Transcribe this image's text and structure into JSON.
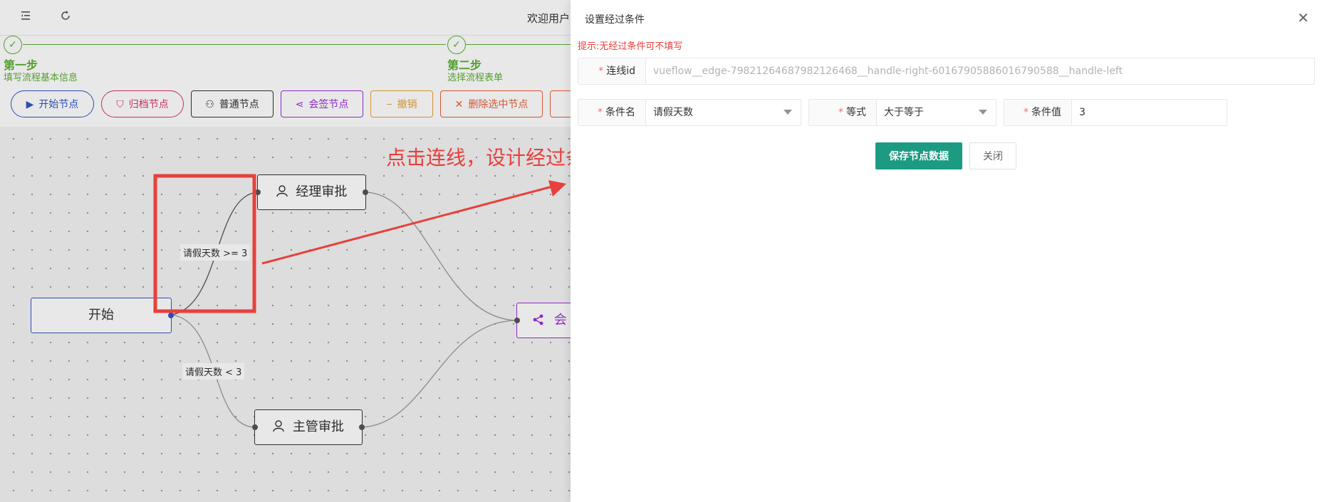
{
  "topbar": {
    "menu_icon": "collapse-menu-icon",
    "refresh_icon": "refresh-icon",
    "welcome": "欢迎用户["
  },
  "steps": [
    {
      "title": "第一步",
      "desc": "填写流程基本信息"
    },
    {
      "title": "第二步",
      "desc": "选择流程表单"
    }
  ],
  "toolbar": {
    "start_node": "开始节点",
    "archive_node": "归档节点",
    "normal_node": "普通节点",
    "countersign_node": "会签节点",
    "undo": "撤销",
    "delete_selected": "删除选中节点"
  },
  "canvas": {
    "nodes": {
      "start": "开始",
      "manager": "经理审批",
      "supervisor": "主管审批",
      "countersign": "会"
    },
    "edges": {
      "upper_label": "请假天数 >= 3",
      "lower_label": "请假天数 < 3"
    }
  },
  "annotation": {
    "text": "点击连线，设计经过条件"
  },
  "drawer": {
    "title": "设置经过条件",
    "close_icon": "close-icon",
    "hint": "提示:无经过条件可不填写",
    "edge_id_label": "连线id",
    "edge_id_value": "vueflow__edge-7982126468798212646​8__handle-right-6016790588601679058​8__handle-left",
    "condition_name_label": "条件名",
    "condition_name_value": "请假天数",
    "operator_label": "等式",
    "operator_value": "大于等于",
    "condition_value_label": "条件值",
    "condition_value_value": "3",
    "save_label": "保存节点数据",
    "close_label": "关闭"
  },
  "colors": {
    "step_green": "#5daf34",
    "annotation_red": "#e8403c",
    "primary_teal": "#1c9b82",
    "start_blue": "#3155c4",
    "archive_pink": "#d9336b",
    "countersign_purple": "#9b2fd6",
    "undo_orange": "#e6a23c",
    "delete_red": "#e8603c"
  }
}
